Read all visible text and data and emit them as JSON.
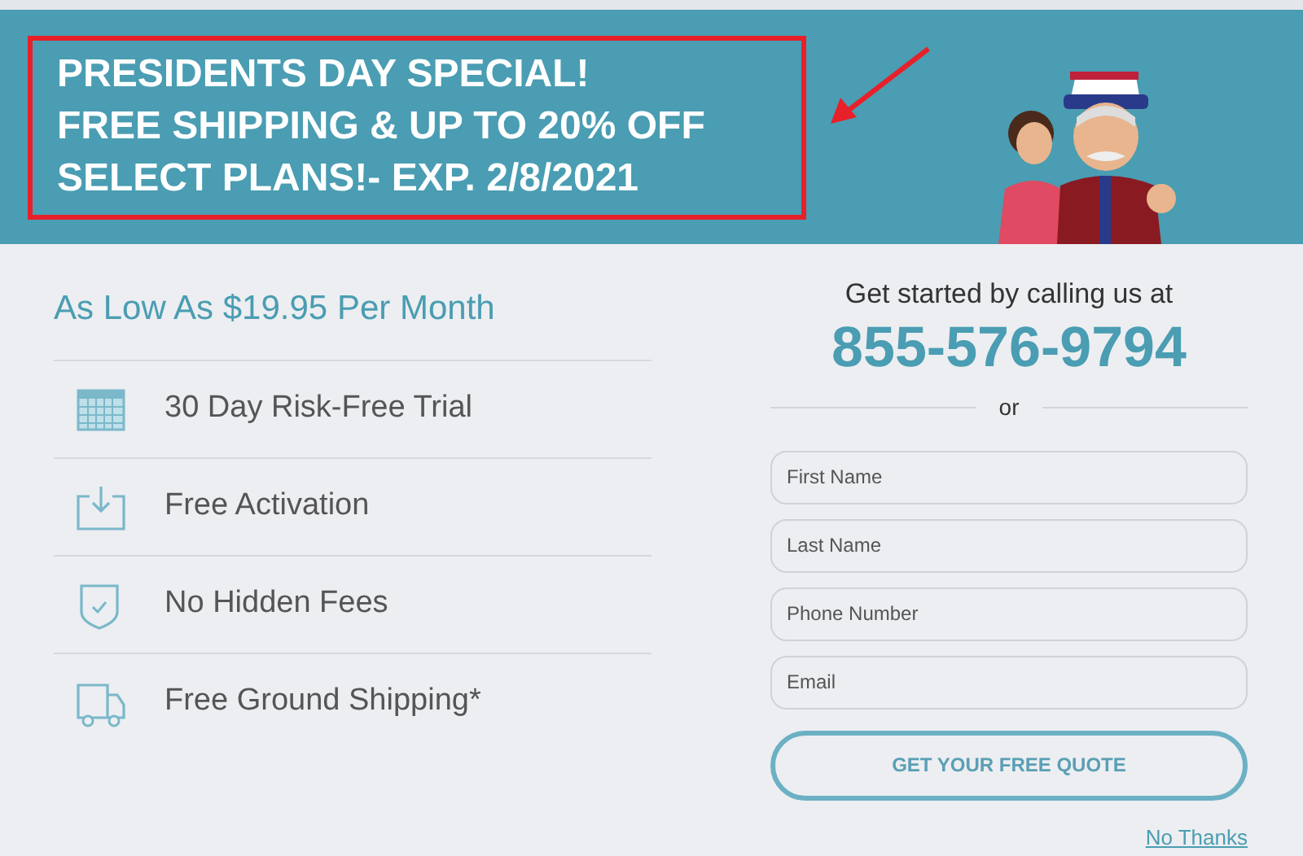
{
  "promo_banner": {
    "headline_lines": [
      "PRESIDENTS DAY SPECIAL!",
      "FREE SHIPPING & UP TO 20% OFF",
      "SELECT PLANS!- EXP. 2/8/2021"
    ]
  },
  "price_heading": "As Low As $19.95 Per Month",
  "features": [
    {
      "kind": "calendar",
      "label": "30 Day Risk-Free Trial"
    },
    {
      "kind": "activation",
      "label": "Free Activation"
    },
    {
      "kind": "shield",
      "label": "No Hidden Fees"
    },
    {
      "kind": "truck",
      "label": "Free Ground Shipping*"
    }
  ],
  "call_prompt": "Get started by calling us at",
  "phone": "855-576-9794",
  "divider_text": "or",
  "fields": [
    {
      "placeholder": "First Name"
    },
    {
      "placeholder": "Last Name"
    },
    {
      "placeholder": "Phone Number"
    },
    {
      "placeholder": "Email"
    }
  ],
  "submit_button": "GET YOUR FREE QUOTE",
  "decline_link": "No Thanks"
}
